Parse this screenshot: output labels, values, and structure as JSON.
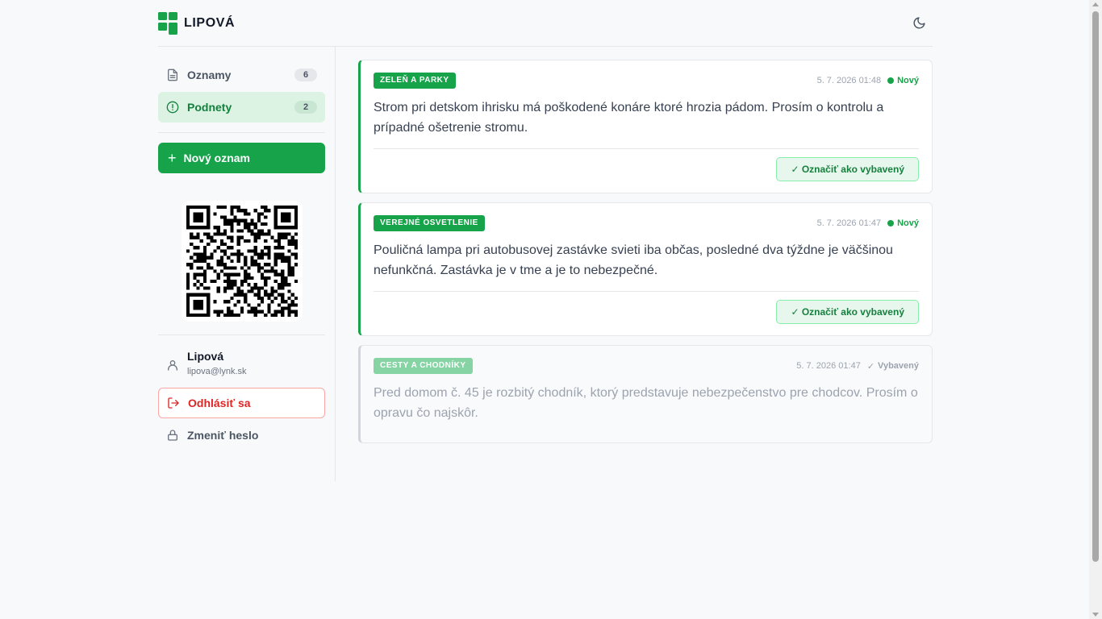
{
  "app": {
    "name": "LIPOVÁ"
  },
  "header": {
    "theme_toggle_icon": "moon-icon"
  },
  "sidebar": {
    "nav": [
      {
        "label": "Oznamy",
        "count": "6",
        "icon": "document-icon"
      },
      {
        "label": "Podnety",
        "count": "2",
        "icon": "alert-circle-icon"
      }
    ],
    "new_button": "Nový oznam",
    "user": {
      "name": "Lipová",
      "email": "lipova@lynk.sk"
    },
    "logout": "Odhlásiť sa",
    "change_password": "Zmeniť heslo"
  },
  "reports": [
    {
      "category": "ZELEŇ A PARKY",
      "datetime": "5. 7. 2026 01:48",
      "status": "Nový",
      "text": "Strom pri detskom ihrisku má poškodené konáre ktoré hrozia pádom. Prosím o kontrolu a prípadné ošetrenie stromu.",
      "action": "Označiť ako vybavený"
    },
    {
      "category": "VEREJNÉ OSVETLENIE",
      "datetime": "5. 7. 2026 01:47",
      "status": "Nový",
      "text": "Pouličná lampa pri autobusovej zastávke svieti iba občas, posledné dva týždne je väčšinou nefunkčná. Zastávka je v tme a je to nebezpečné.",
      "action": "Označiť ako vybavený"
    },
    {
      "category": "CESTY A CHODNÍKY",
      "datetime": "5. 7. 2026 01:47",
      "status": "Vybavený",
      "text": "Pred domom č. 45 je rozbitý chodník, ktorý predstavuje nebezpečenstvo pre chodcov. Prosím o opravu čo najskôr."
    }
  ],
  "colors": {
    "accent": "#16a34a",
    "danger": "#dc2626"
  }
}
